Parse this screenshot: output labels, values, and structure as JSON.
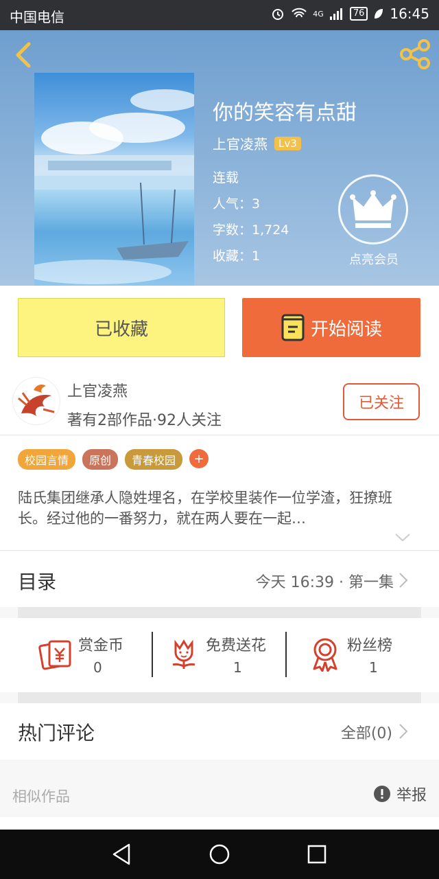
{
  "status_bar": {
    "carrier": "中国电信",
    "network": "4G",
    "battery": "76",
    "time": "16:45"
  },
  "book": {
    "title": "你的笑容有点甜",
    "author": "上官凌燕",
    "level": "Lv3",
    "status": "连载",
    "popularity": "人气：3",
    "word_count": "字数：1,724",
    "favorites": "收藏：1",
    "vip_label": "点亮会员"
  },
  "actions": {
    "collected_label": "已收藏",
    "read_label": "开始阅读"
  },
  "author_card": {
    "name": "上官凌燕",
    "stats": "著有2部作品·92人关注",
    "follow_label": "已关注"
  },
  "tags": [
    {
      "label": "校园言情",
      "color": "#f0a63a"
    },
    {
      "label": "原创",
      "color": "#c9745b"
    },
    {
      "label": "青春校园",
      "color": "#c99a3c"
    }
  ],
  "tag_add": "+",
  "intro": "陆氏集团继承人隐姓埋名，在学校里装作一位学渣，狂撩班长。经过他的一番努力，就在两人要在一起…",
  "catalog": {
    "title": "目录",
    "latest": "今天 16:39 · 第一集"
  },
  "rewards": [
    {
      "label": "赏金币",
      "value": "0",
      "icon": "reward-coin-icon"
    },
    {
      "label": "免费送花",
      "value": "1",
      "icon": "flower-icon"
    },
    {
      "label": "粉丝榜",
      "value": "1",
      "icon": "medal-icon"
    }
  ],
  "comments": {
    "title": "热门评论",
    "all_label": "全部(0)"
  },
  "similar": {
    "label": "相似作品",
    "report_label": "举报"
  },
  "colors": {
    "accent": "#ef6b3c",
    "collected_bg": "#fdf47f",
    "follow": "#e05a3a"
  }
}
